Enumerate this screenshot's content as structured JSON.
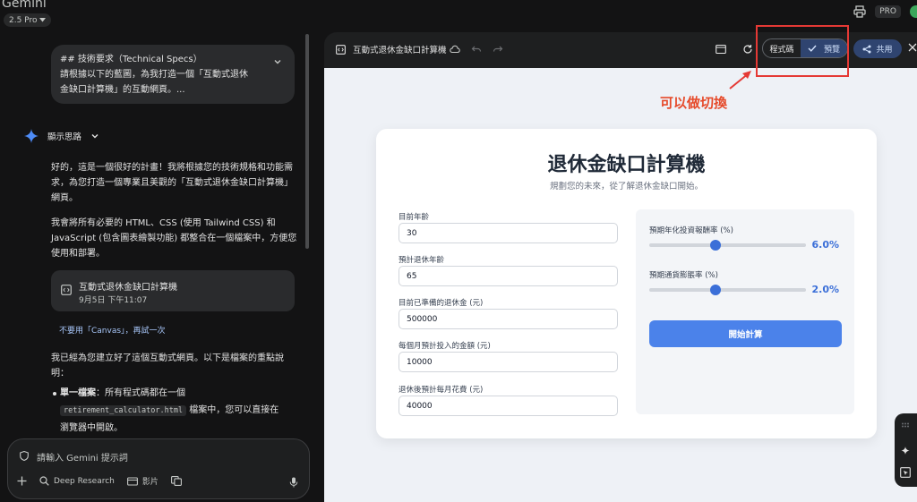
{
  "app": {
    "brand": "Gemini",
    "model": "2.5 Pro",
    "pro_badge": "PRO"
  },
  "chat": {
    "user_message_line1": "## 技術要求（Technical Specs）",
    "user_message_line2": "請根據以下的藍圖，為我打造一個「互動式退休",
    "user_message_line3": "金缺口計算機」的互動網頁。...",
    "thinking_label": "顯示思路",
    "para1_line1": "好的，這是一個很好的計畫！我將根據您的技術規格和功能需",
    "para1_line2": "求，為您打造一個專業且美觀的「互動式退休金缺口計算機」",
    "para1_line3": "網頁。",
    "para2_line1": "我會將所有必要的 HTML、CSS (使用 Tailwind CSS) 和",
    "para2_line2": "JavaScript (包含圖表繪製功能) 都整合在一個檔案中，方便您",
    "para2_line3": "使用和部署。",
    "doc_title": "互動式退休金缺口計算機",
    "doc_time": "9月5日 下午11:07",
    "retry_link": "不要用「Canvas」，再試一次",
    "para3_line1": "我已經為您建立好了這個互動式網頁。以下是檔案的重點說",
    "para3_line2": "明：",
    "bullet_bold": "單一檔案",
    "bullet_text1": "：所有程式碼都在一個",
    "bullet_code": "retirement_calculator.html",
    "bullet_text2": "檔案中，您可以直接在",
    "bullet_text3": "瀏覽器中開啟。",
    "input_placeholder": "請輸入 Gemini 提示詞",
    "tool_deep_research": "Deep Research",
    "tool_video": "影片"
  },
  "canvas": {
    "title": "互動式退休金缺口計算機",
    "seg_code": "程式碼",
    "seg_preview": "預覽",
    "share": "共用"
  },
  "calculator": {
    "title": "退休金缺口計算機",
    "subtitle": "規劃您的未來，從了解退休金缺口開始。",
    "fields": [
      {
        "label": "目前年齡",
        "value": "30"
      },
      {
        "label": "預計退休年齡",
        "value": "65"
      },
      {
        "label": "目前已準備的退休金 (元)",
        "value": "500000"
      },
      {
        "label": "每個月預計投入的金額 (元)",
        "value": "10000"
      },
      {
        "label": "退休後預計每月花費 (元)",
        "value": "40000"
      }
    ],
    "sliders": [
      {
        "label": "預期年化投資報酬率 (%)",
        "value_text": "6.0%",
        "level": 0.42
      },
      {
        "label": "預期通貨膨脹率 (%)",
        "value_text": "2.0%",
        "level": 0.42
      }
    ],
    "button": "開始計算"
  },
  "annotation": {
    "text": "可以做切換",
    "color": "#e64a2a"
  },
  "colors": {
    "accent": "#3b6fd8",
    "button": "#4b82ea",
    "highlight_box": "#e53935"
  }
}
